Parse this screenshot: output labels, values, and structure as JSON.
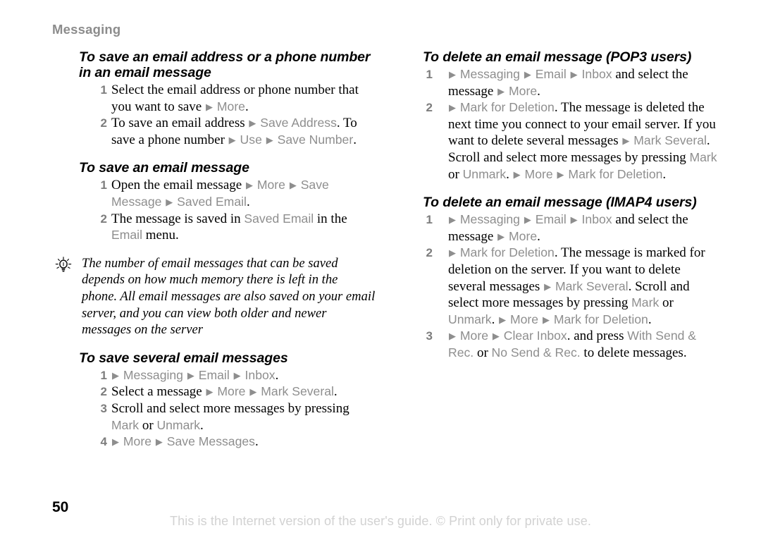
{
  "header": {
    "running_title": "Messaging"
  },
  "footer": {
    "page_number": "50",
    "notice": "This is the Internet version of the user's guide. © Print only for private use."
  },
  "icons": {
    "tip": "lightbulb-tip-icon",
    "arrow": "▶"
  },
  "colors": {
    "ui_term": "#8e8e8e",
    "step_number": "#7d7d7d",
    "running_header": "#8c8c8c",
    "footer_notice": "#d2d2d2",
    "body_text": "#000000"
  },
  "left_column": {
    "sections": [
      {
        "heading": "To save an email address or a phone number in an email message",
        "steps": [
          {
            "number": "1",
            "runs": [
              {
                "t": "Select the email address or phone number that you want to save ",
                "s": "body"
              },
              {
                "t": "▶",
                "s": "arrow"
              },
              {
                "t": " More",
                "s": "ui"
              },
              {
                "t": ".",
                "s": "body"
              }
            ]
          },
          {
            "number": "2",
            "runs": [
              {
                "t": "To save an email address ",
                "s": "body"
              },
              {
                "t": "▶",
                "s": "arrow"
              },
              {
                "t": " Save Address",
                "s": "ui"
              },
              {
                "t": ". To save a phone number ",
                "s": "body"
              },
              {
                "t": "▶",
                "s": "arrow"
              },
              {
                "t": " Use ",
                "s": "ui"
              },
              {
                "t": "▶",
                "s": "arrow"
              },
              {
                "t": " Save Number",
                "s": "ui"
              },
              {
                "t": ".",
                "s": "body"
              }
            ]
          }
        ]
      },
      {
        "heading": "To save an email message",
        "steps": [
          {
            "number": "1",
            "runs": [
              {
                "t": "Open the email message ",
                "s": "body"
              },
              {
                "t": "▶",
                "s": "arrow"
              },
              {
                "t": " More ",
                "s": "ui"
              },
              {
                "t": "▶",
                "s": "arrow"
              },
              {
                "t": " Save Message ",
                "s": "ui"
              },
              {
                "t": "▶",
                "s": "arrow"
              },
              {
                "t": " Saved Email",
                "s": "ui"
              },
              {
                "t": ".",
                "s": "body"
              }
            ]
          },
          {
            "number": "2",
            "runs": [
              {
                "t": "The message is saved in ",
                "s": "body"
              },
              {
                "t": "Saved Email",
                "s": "ui"
              },
              {
                "t": " in the ",
                "s": "body"
              },
              {
                "t": "Email",
                "s": "ui"
              },
              {
                "t": " menu.",
                "s": "body"
              }
            ]
          }
        ]
      }
    ],
    "tip": {
      "icon": "lightbulb-tip-icon",
      "text": "The number of email messages that can be saved depends on how much memory there is left in the phone. All email messages are also saved on your email server, and you can view both older and newer messages on the server"
    },
    "sections_after_tip": [
      {
        "heading": "To save several email messages",
        "steps": [
          {
            "number": "1",
            "runs": [
              {
                "t": "▶",
                "s": "arrow"
              },
              {
                "t": " Messaging ",
                "s": "ui"
              },
              {
                "t": "▶",
                "s": "arrow"
              },
              {
                "t": " Email ",
                "s": "ui"
              },
              {
                "t": "▶",
                "s": "arrow"
              },
              {
                "t": " Inbox",
                "s": "ui"
              },
              {
                "t": ".",
                "s": "body"
              }
            ]
          },
          {
            "number": "2",
            "runs": [
              {
                "t": "Select a message ",
                "s": "body"
              },
              {
                "t": "▶",
                "s": "arrow"
              },
              {
                "t": " More ",
                "s": "ui"
              },
              {
                "t": "▶",
                "s": "arrow"
              },
              {
                "t": " Mark Several",
                "s": "ui"
              },
              {
                "t": ".",
                "s": "body"
              }
            ]
          },
          {
            "number": "3",
            "runs": [
              {
                "t": "Scroll and select more messages by pressing ",
                "s": "body"
              },
              {
                "t": "Mark",
                "s": "ui"
              },
              {
                "t": " or ",
                "s": "body"
              },
              {
                "t": "Unmark",
                "s": "ui"
              },
              {
                "t": ".",
                "s": "body"
              }
            ]
          },
          {
            "number": "4",
            "runs": [
              {
                "t": "▶",
                "s": "arrow"
              },
              {
                "t": " More ",
                "s": "ui"
              },
              {
                "t": "▶",
                "s": "arrow"
              },
              {
                "t": " Save Messages",
                "s": "ui"
              },
              {
                "t": ".",
                "s": "body"
              }
            ]
          }
        ]
      }
    ]
  },
  "right_column": {
    "sections": [
      {
        "heading": "To delete an email message (POP3 users)",
        "steps": [
          {
            "number": "1",
            "runs": [
              {
                "t": "▶",
                "s": "arrow"
              },
              {
                "t": " Messaging ",
                "s": "ui"
              },
              {
                "t": "▶",
                "s": "arrow"
              },
              {
                "t": " Email ",
                "s": "ui"
              },
              {
                "t": "▶",
                "s": "arrow"
              },
              {
                "t": " Inbox",
                "s": "ui"
              },
              {
                "t": " and select the message ",
                "s": "body"
              },
              {
                "t": "▶",
                "s": "arrow"
              },
              {
                "t": " More",
                "s": "ui"
              },
              {
                "t": ".",
                "s": "body"
              }
            ]
          },
          {
            "number": "2",
            "runs": [
              {
                "t": "▶",
                "s": "arrow"
              },
              {
                "t": " Mark for Deletion",
                "s": "ui"
              },
              {
                "t": ". The message is deleted the next time you connect to your email server. If you want to delete several messages ",
                "s": "body"
              },
              {
                "t": "▶",
                "s": "arrow"
              },
              {
                "t": " Mark Several",
                "s": "ui"
              },
              {
                "t": ". Scroll and select more messages by pressing ",
                "s": "body"
              },
              {
                "t": "Mark",
                "s": "ui"
              },
              {
                "t": " or ",
                "s": "body"
              },
              {
                "t": "Unmark",
                "s": "ui"
              },
              {
                "t": ". ",
                "s": "body"
              },
              {
                "t": "▶",
                "s": "arrow"
              },
              {
                "t": " More ",
                "s": "ui"
              },
              {
                "t": "▶",
                "s": "arrow"
              },
              {
                "t": " Mark for Deletion",
                "s": "ui"
              },
              {
                "t": ".",
                "s": "body"
              }
            ]
          }
        ]
      },
      {
        "heading": "To delete an email message (IMAP4 users)",
        "steps": [
          {
            "number": "1",
            "runs": [
              {
                "t": "▶",
                "s": "arrow"
              },
              {
                "t": " Messaging ",
                "s": "ui"
              },
              {
                "t": "▶",
                "s": "arrow"
              },
              {
                "t": " Email ",
                "s": "ui"
              },
              {
                "t": "▶",
                "s": "arrow"
              },
              {
                "t": " Inbox",
                "s": "ui"
              },
              {
                "t": " and select the message ",
                "s": "body"
              },
              {
                "t": "▶",
                "s": "arrow"
              },
              {
                "t": " More",
                "s": "ui"
              },
              {
                "t": ".",
                "s": "body"
              }
            ]
          },
          {
            "number": "2",
            "runs": [
              {
                "t": "▶",
                "s": "arrow"
              },
              {
                "t": " Mark for Deletion",
                "s": "ui"
              },
              {
                "t": ". The message is marked for deletion on the server. If you want to delete several messages ",
                "s": "body"
              },
              {
                "t": "▶",
                "s": "arrow"
              },
              {
                "t": " Mark Several",
                "s": "ui"
              },
              {
                "t": ". Scroll and select more messages by pressing ",
                "s": "body"
              },
              {
                "t": "Mark",
                "s": "ui"
              },
              {
                "t": " or ",
                "s": "body"
              },
              {
                "t": "Unmark",
                "s": "ui"
              },
              {
                "t": ". ",
                "s": "body"
              },
              {
                "t": "▶",
                "s": "arrow"
              },
              {
                "t": " More ",
                "s": "ui"
              },
              {
                "t": "▶",
                "s": "arrow"
              },
              {
                "t": " Mark for Deletion",
                "s": "ui"
              },
              {
                "t": ".",
                "s": "body"
              }
            ]
          },
          {
            "number": "3",
            "runs": [
              {
                "t": "▶",
                "s": "arrow"
              },
              {
                "t": " More ",
                "s": "ui"
              },
              {
                "t": "▶",
                "s": "arrow"
              },
              {
                "t": " Clear Inbox",
                "s": "ui"
              },
              {
                "t": ". and press ",
                "s": "body"
              },
              {
                "t": "With Send & Rec.",
                "s": "ui"
              },
              {
                "t": " or ",
                "s": "body"
              },
              {
                "t": "No Send & Rec.",
                "s": "ui"
              },
              {
                "t": " to delete messages.",
                "s": "body"
              }
            ]
          }
        ]
      }
    ]
  }
}
